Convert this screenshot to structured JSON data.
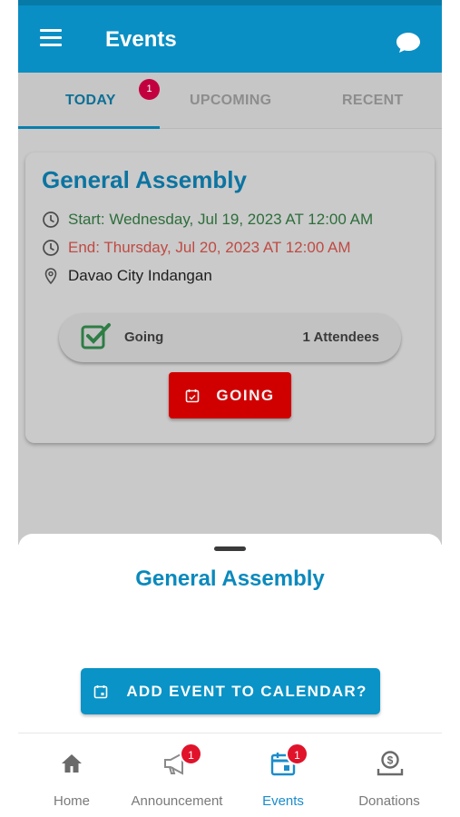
{
  "appbar": {
    "title": "Events",
    "menu_icon": "hamburger-menu-icon",
    "chat_icon": "chat-bubble-icon",
    "color": "#0a8fc4"
  },
  "tabs": [
    {
      "label": "TODAY",
      "active": true,
      "badge": "1"
    },
    {
      "label": "UPCOMING",
      "active": false
    },
    {
      "label": "RECENT",
      "active": false
    }
  ],
  "event_card": {
    "title": "General Assembly",
    "start": "Start: Wednesday, Jul 19, 2023 AT 12:00 AM",
    "end": "End: Thursday, Jul 20, 2023 AT 12:00 AM",
    "location": "Davao City Indangan",
    "status_label": "Going",
    "attendees": "1 Attendees",
    "going_button": "GOING",
    "colors": {
      "title": "#0c74a1",
      "start": "#2d6e3b",
      "end": "#bf4a43",
      "going_button": "#d10000"
    }
  },
  "sheet": {
    "title": "General Assembly",
    "action_button": "ADD EVENT TO CALENDAR?"
  },
  "bottom_nav": [
    {
      "label": "Home",
      "icon": "home-icon",
      "active": false
    },
    {
      "label": "Announcement",
      "icon": "megaphone-icon",
      "active": false,
      "badge": "1"
    },
    {
      "label": "Events",
      "icon": "calendar-icon",
      "active": true,
      "badge": "1"
    },
    {
      "label": "Donations",
      "icon": "donation-icon",
      "active": false
    }
  ]
}
